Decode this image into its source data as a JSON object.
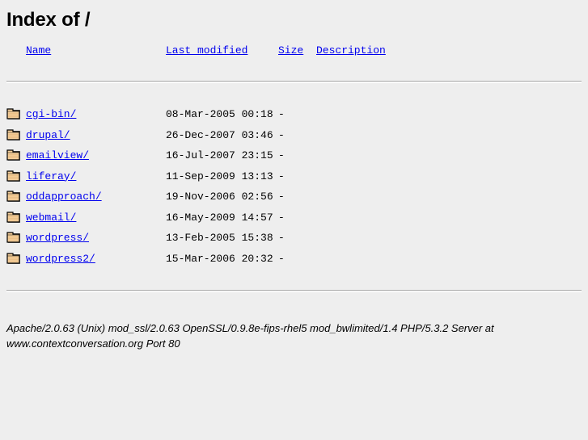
{
  "page": {
    "title": "Index of /",
    "doc_title": "Index of /"
  },
  "colors": {
    "background": "#eeeeee",
    "link": "#0000ee",
    "text": "#000000",
    "rule": "#b0b0b0",
    "folder_body": "#f5cf9b",
    "folder_outline": "#000000",
    "folder_shadow": "#808080"
  },
  "table": {
    "headers": {
      "icon": "",
      "name": "Name",
      "last_modified": "Last modified",
      "size": "Size",
      "description": "Description"
    },
    "rows": [
      {
        "icon": "folder-icon",
        "name": "cgi-bin/",
        "last_modified": "08-Mar-2005 00:18",
        "size": "-",
        "description": ""
      },
      {
        "icon": "folder-icon",
        "name": "drupal/",
        "last_modified": "26-Dec-2007 03:46",
        "size": "-",
        "description": ""
      },
      {
        "icon": "folder-icon",
        "name": "emailview/",
        "last_modified": "16-Jul-2007 23:15",
        "size": "-",
        "description": ""
      },
      {
        "icon": "folder-icon",
        "name": "liferay/",
        "last_modified": "11-Sep-2009 13:13",
        "size": "-",
        "description": ""
      },
      {
        "icon": "folder-icon",
        "name": "oddapproach/",
        "last_modified": "19-Nov-2006 02:56",
        "size": "-",
        "description": ""
      },
      {
        "icon": "folder-icon",
        "name": "webmail/",
        "last_modified": "16-May-2009 14:57",
        "size": "-",
        "description": ""
      },
      {
        "icon": "folder-icon",
        "name": "wordpress/",
        "last_modified": "13-Feb-2005 15:38",
        "size": "-",
        "description": ""
      },
      {
        "icon": "folder-icon",
        "name": "wordpress2/",
        "last_modified": "15-Mar-2006 20:32",
        "size": "-",
        "description": ""
      }
    ]
  },
  "footer": {
    "signature": "Apache/2.0.63 (Unix) mod_ssl/2.0.63 OpenSSL/0.9.8e-fips-rhel5 mod_bwlimited/1.4 PHP/5.3.2 Server at www.contextconversation.org Port 80"
  }
}
